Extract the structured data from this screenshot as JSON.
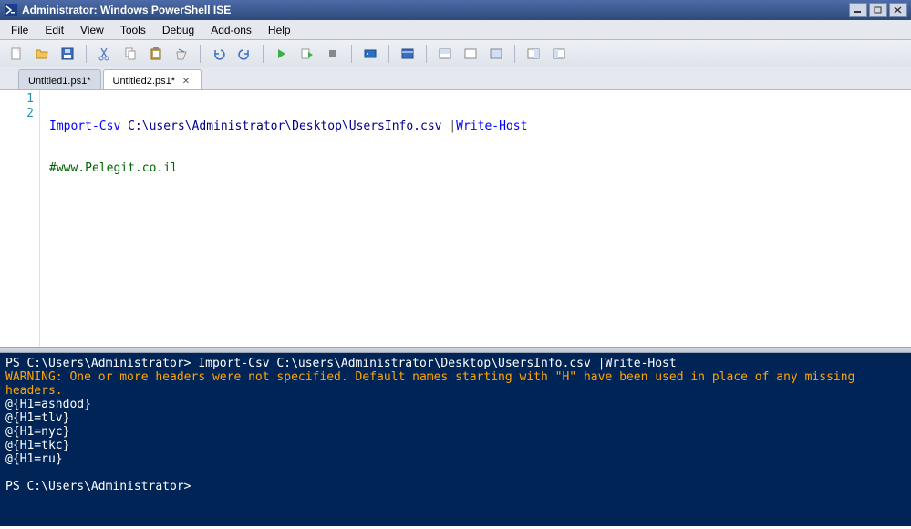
{
  "titlebar": {
    "title": "Administrator: Windows PowerShell ISE"
  },
  "menu": {
    "file": "File",
    "edit": "Edit",
    "view": "View",
    "tools": "Tools",
    "debug": "Debug",
    "addons": "Add-ons",
    "help": "Help"
  },
  "tabs": [
    {
      "label": "Untitled1.ps1*",
      "active": false
    },
    {
      "label": "Untitled2.ps1*",
      "active": true
    }
  ],
  "editor": {
    "lines": [
      "1",
      "2"
    ],
    "code": {
      "l1_cmd": "Import-Csv",
      "l1_path": "C:\\users\\Administrator\\Desktop\\UsersInfo.csv",
      "l1_pipe": "|",
      "l1_cmd2": "Write-Host",
      "l2_comment": "#www.Pelegit.co.il"
    }
  },
  "console": {
    "line1_prompt": "PS C:\\Users\\Administrator> ",
    "line1_cmd": "Import-Csv C:\\users\\Administrator\\Desktop\\UsersInfo.csv |Write-Host",
    "warning": "WARNING: One or more headers were not specified. Default names starting with \"H\" have been used in place of any missing headers.",
    "out1": "@{H1=ashdod}",
    "out2": "@{H1=tlv}",
    "out3": "@{H1=nyc}",
    "out4": "@{H1=tkc}",
    "out5": "@{H1=ru}",
    "line2_prompt": "PS C:\\Users\\Administrator>"
  }
}
